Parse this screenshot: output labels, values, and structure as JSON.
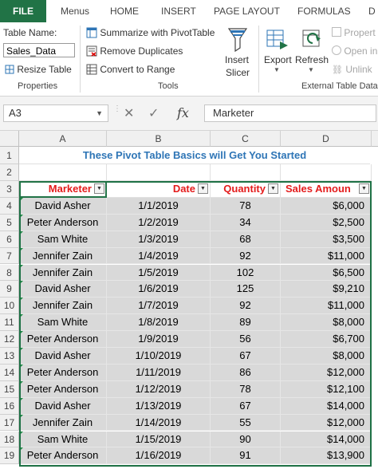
{
  "tabs": [
    "FILE",
    "MENUS",
    "HOME",
    "INSERT",
    "PAGE LAYOUT",
    "FORMULAS",
    "D"
  ],
  "tab_labels": [
    "FILE",
    "Menus",
    "HOME",
    "INSERT",
    "PAGE LAYOUT",
    "FORMULAS",
    "D"
  ],
  "ribbon": {
    "properties": {
      "table_name_label": "Table Name:",
      "table_name_value": "Sales_Data",
      "resize_table": "Resize Table",
      "group_label": "Properties"
    },
    "tools": {
      "summarize": "Summarize with PivotTable",
      "remove_duplicates": "Remove Duplicates",
      "convert_to_range": "Convert to Range",
      "insert_slicer": [
        "Insert",
        "Slicer"
      ],
      "group_label": "Tools"
    },
    "external": {
      "export": "Export",
      "refresh": "Refresh",
      "properties": "Propert",
      "open_in": "Open in",
      "unlink": "Unlink",
      "group_label": "External Table Data"
    }
  },
  "formula_bar": {
    "name_box": "A3",
    "formula": "Marketer"
  },
  "columns": [
    "A",
    "B",
    "C",
    "D"
  ],
  "title": "These Pivot Table Basics will Get You Started",
  "table": {
    "headers": [
      "Marketer",
      "Date",
      "Quantity",
      "Sales Amoun"
    ],
    "rows": [
      [
        "David Asher",
        "1/1/2019",
        "78",
        "$6,000"
      ],
      [
        "Peter Anderson",
        "1/2/2019",
        "34",
        "$2,500"
      ],
      [
        "Sam White",
        "1/3/2019",
        "68",
        "$3,500"
      ],
      [
        "Jennifer Zain",
        "1/4/2019",
        "92",
        "$11,000"
      ],
      [
        "Jennifer Zain",
        "1/5/2019",
        "102",
        "$6,500"
      ],
      [
        "David Asher",
        "1/6/2019",
        "125",
        "$9,210"
      ],
      [
        "Jennifer Zain",
        "1/7/2019",
        "92",
        "$11,000"
      ],
      [
        "Sam White",
        "1/8/2019",
        "89",
        "$8,000"
      ],
      [
        "Peter Anderson",
        "1/9/2019",
        "56",
        "$6,700"
      ],
      [
        "David Asher",
        "1/10/2019",
        "67",
        "$8,000"
      ],
      [
        "Peter Anderson",
        "1/11/2019",
        "86",
        "$12,000"
      ],
      [
        "Peter Anderson",
        "1/12/2019",
        "78",
        "$12,100"
      ],
      [
        "David Asher",
        "1/13/2019",
        "67",
        "$14,000"
      ],
      [
        "Jennifer Zain",
        "1/14/2019",
        "55",
        "$12,000"
      ],
      [
        "Sam White",
        "1/15/2019",
        "90",
        "$14,000"
      ],
      [
        "Peter Anderson",
        "1/16/2019",
        "91",
        "$13,900"
      ]
    ]
  },
  "row_numbers": [
    "1",
    "2",
    "3",
    "4",
    "5",
    "6",
    "7",
    "8",
    "9",
    "10",
    "11",
    "12",
    "13",
    "14",
    "15",
    "16",
    "17",
    "18",
    "19"
  ],
  "colors": {
    "accent": "#217346",
    "header_text": "#e41c1c",
    "title_text": "#2e75b6",
    "table_fill": "#d9d9d9"
  }
}
